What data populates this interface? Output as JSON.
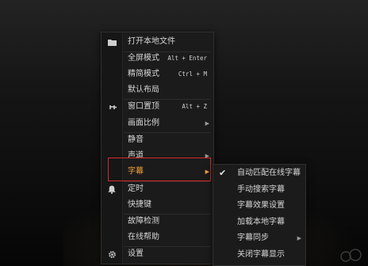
{
  "main_menu": {
    "items": [
      {
        "label": "打开本地文件",
        "shortcut": "",
        "icon": "folder-icon",
        "submenu": false
      },
      {
        "label": "全屏模式",
        "shortcut": "Alt + Enter",
        "icon": "",
        "submenu": false
      },
      {
        "label": "精简模式",
        "shortcut": "Ctrl + M",
        "icon": "",
        "submenu": false
      },
      {
        "label": "默认布局",
        "shortcut": "",
        "icon": "",
        "submenu": false
      },
      {
        "label": "窗口置顶",
        "shortcut": "Alt + Z",
        "icon": "pin-icon",
        "submenu": false
      },
      {
        "label": "画面比例",
        "shortcut": "",
        "icon": "",
        "submenu": true
      },
      {
        "label": "静音",
        "shortcut": "",
        "icon": "",
        "submenu": false
      },
      {
        "label": "声道",
        "shortcut": "",
        "icon": "",
        "submenu": true
      },
      {
        "label": "字幕",
        "shortcut": "",
        "icon": "",
        "submenu": true,
        "highlighted": true
      },
      {
        "label": "定时",
        "shortcut": "",
        "icon": "bell-icon",
        "submenu": false
      },
      {
        "label": "快捷键",
        "shortcut": "",
        "icon": "",
        "submenu": false
      },
      {
        "label": "故障检测",
        "shortcut": "",
        "icon": "",
        "submenu": false
      },
      {
        "label": "在线帮助",
        "shortcut": "",
        "icon": "",
        "submenu": false
      },
      {
        "label": "设置",
        "shortcut": "",
        "icon": "gear-icon",
        "submenu": false
      }
    ]
  },
  "subtitle_menu": {
    "items": [
      {
        "label": "自动匹配在线字幕",
        "checked": true,
        "submenu": false
      },
      {
        "label": "手动搜索字幕",
        "checked": false,
        "submenu": false
      },
      {
        "label": "字幕效果设置",
        "checked": false,
        "submenu": false
      },
      {
        "label": "加载本地字幕",
        "checked": false,
        "submenu": false
      },
      {
        "label": "字幕同步",
        "checked": false,
        "submenu": true
      },
      {
        "label": "关闭字幕显示",
        "checked": false,
        "submenu": false
      }
    ]
  },
  "colors": {
    "highlight_text": "#f2a23a",
    "highlight_border": "#d62a2a",
    "menu_bg": "#1b1b1b"
  }
}
